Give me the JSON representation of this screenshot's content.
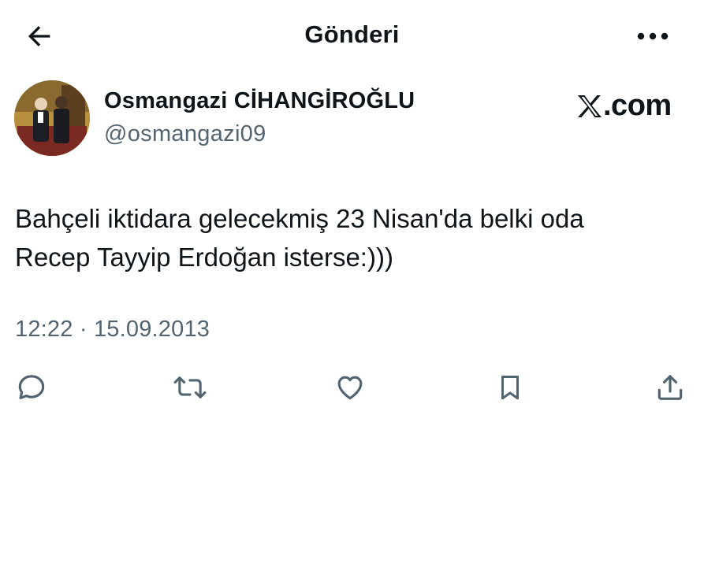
{
  "header": {
    "title": "Gönderi",
    "back_icon": "arrow-left-icon",
    "more_icon": "more-horizontal-icon"
  },
  "post": {
    "author": {
      "display_name": "Osmangazi CİHANGİROĞLU",
      "handle": "@osmangazi09",
      "avatar": "avatar-photo"
    },
    "brand": {
      "logo_icon": "x-logo-icon",
      "suffix": ".com"
    },
    "text_lines": [
      "Bahçeli iktidara gelecekmiş 23 Nisan'da belki oda",
      "Recep Tayyip Erdoğan isterse:)))"
    ],
    "time": "12:22",
    "separator": " · ",
    "date": "15.09.2013"
  },
  "actions": {
    "reply_icon": "reply-icon",
    "repost_icon": "repost-icon",
    "like_icon": "heart-icon",
    "bookmark_icon": "bookmark-icon",
    "share_icon": "share-icon"
  },
  "colors": {
    "text_primary": "#0f1419",
    "text_secondary": "#536471",
    "icon": "#536471",
    "background": "#ffffff"
  }
}
